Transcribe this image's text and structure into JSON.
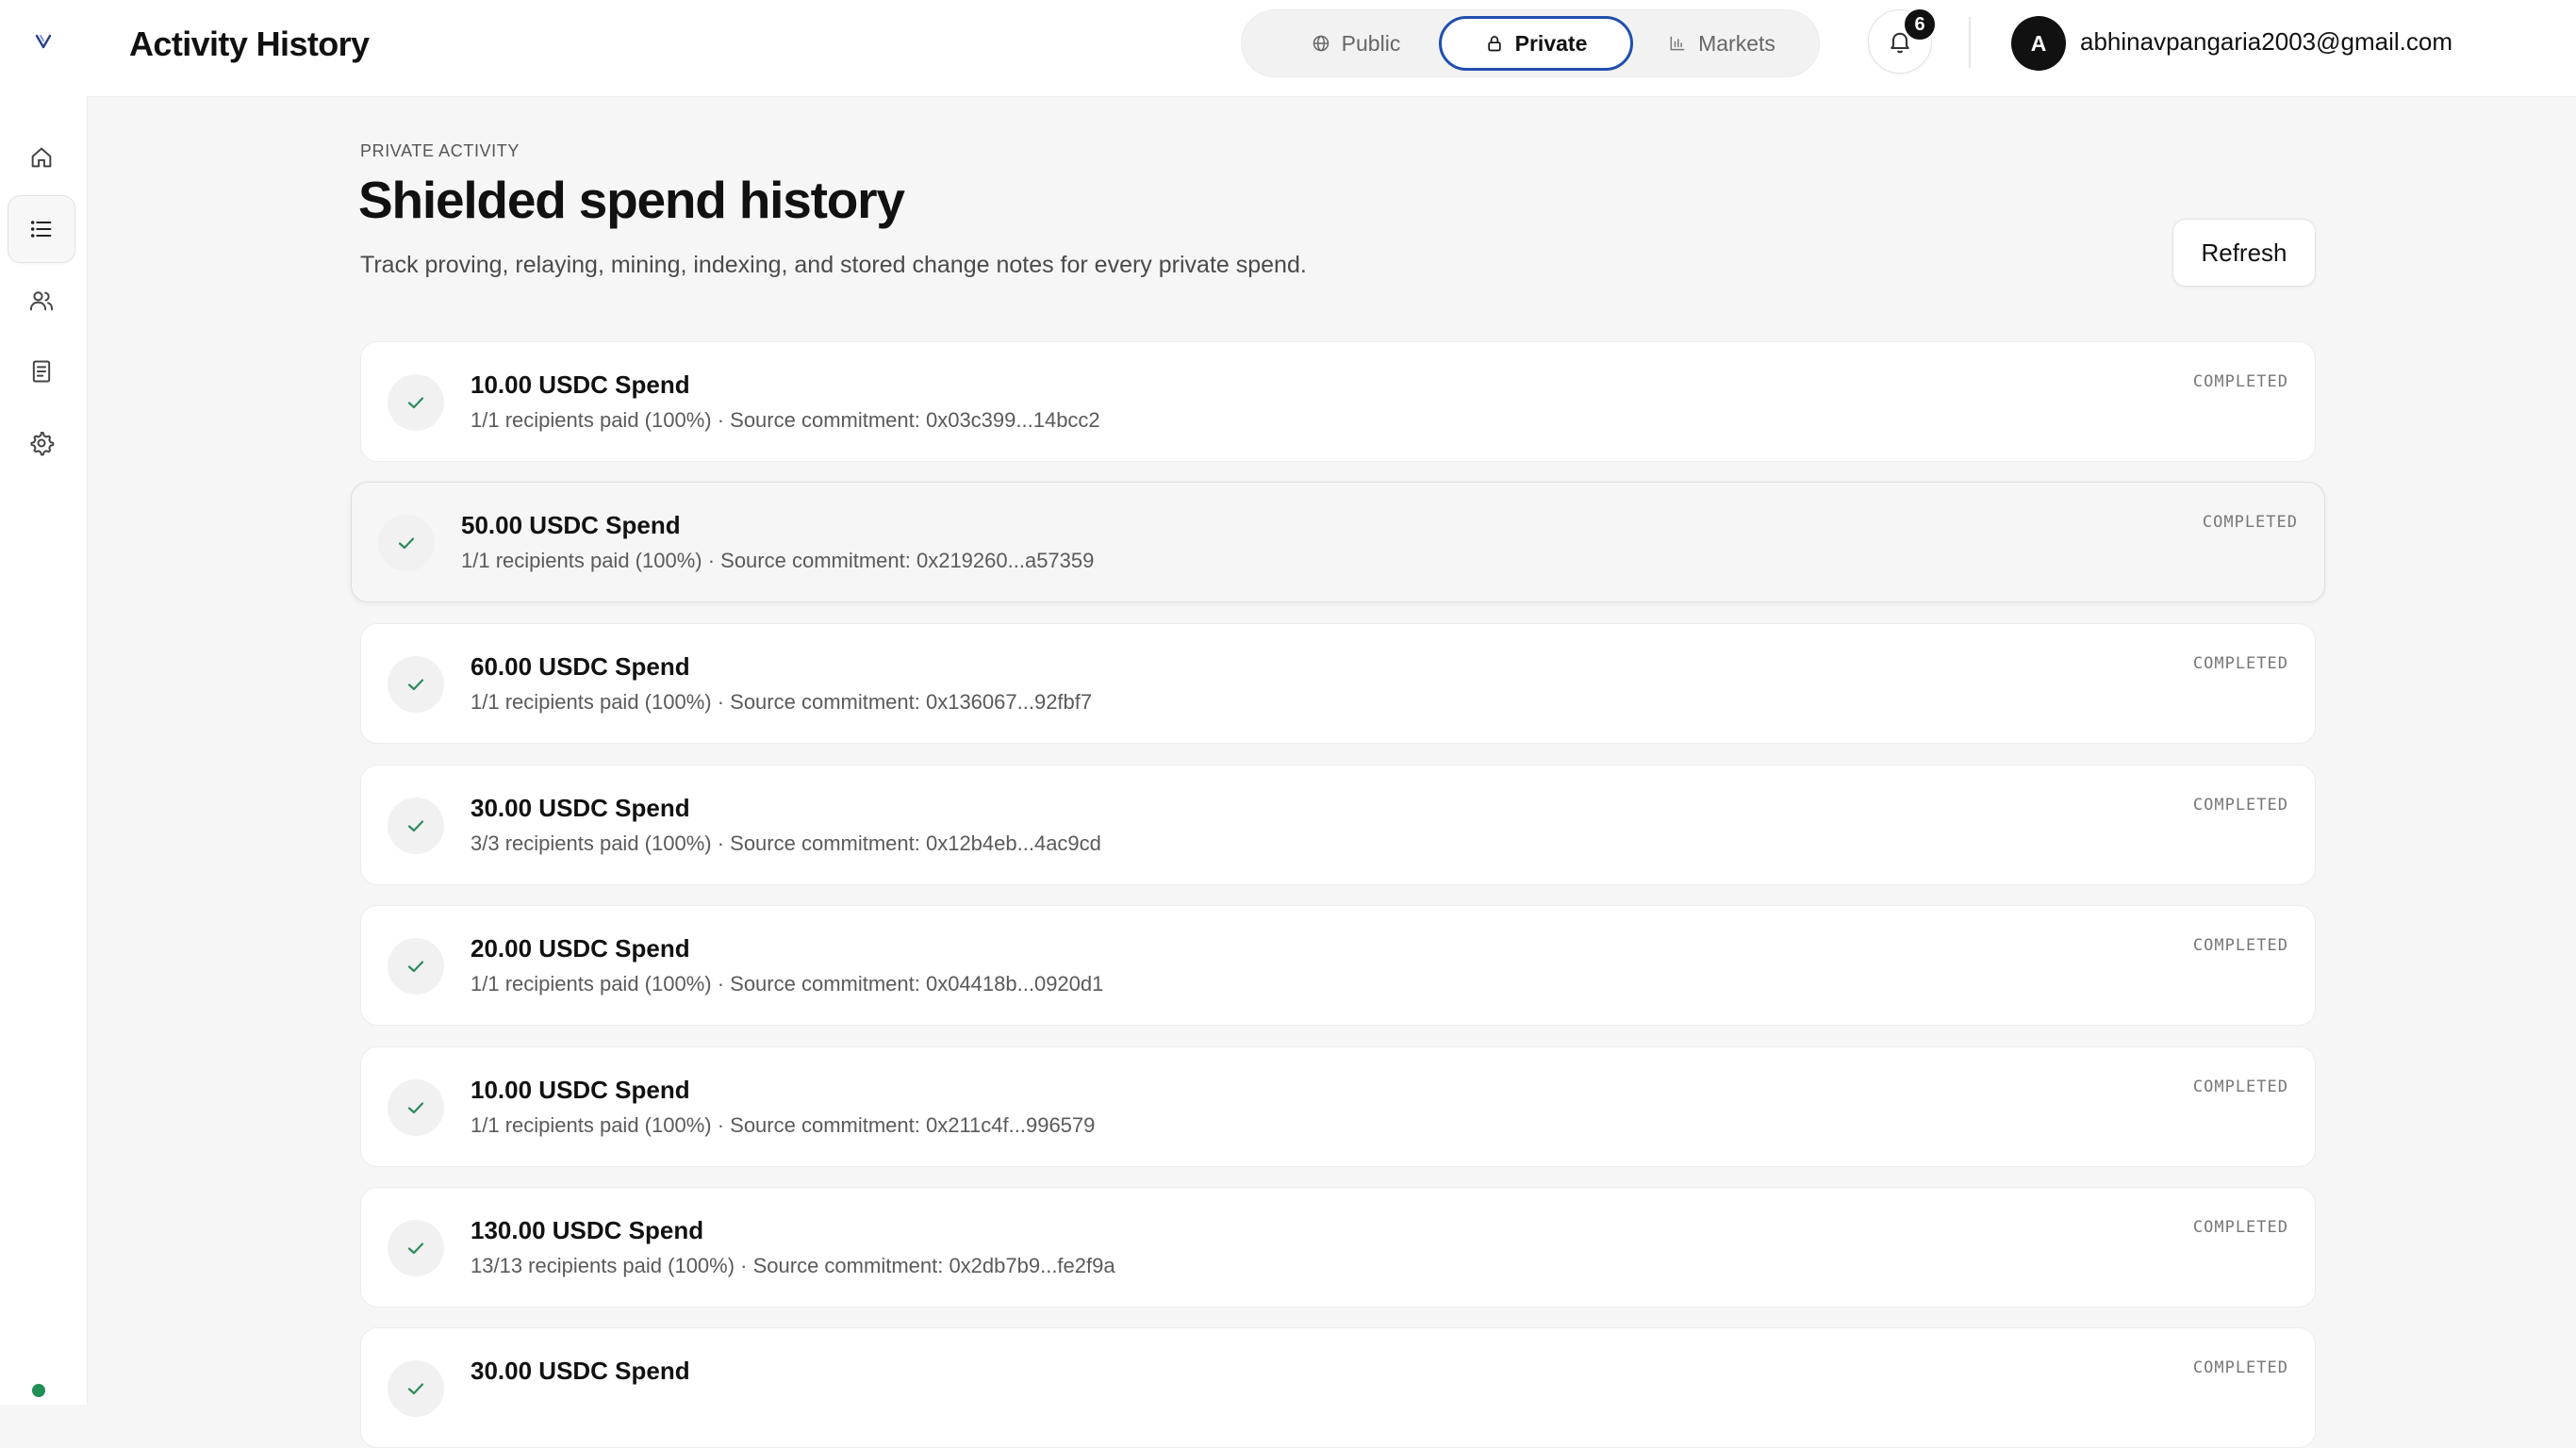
{
  "header": {
    "title": "Activity History",
    "modes": [
      {
        "label": "Public",
        "icon": "globe-icon"
      },
      {
        "label": "Private",
        "icon": "lock-icon",
        "active": true
      },
      {
        "label": "Markets",
        "icon": "bar-chart-icon"
      }
    ],
    "notifications_count": "6",
    "user_initial": "A",
    "user_email": "abhinavpangaria2003@gmail.com"
  },
  "sidebar": {
    "items": [
      {
        "icon": "home-icon"
      },
      {
        "icon": "list-icon",
        "active": true
      },
      {
        "icon": "users-icon"
      },
      {
        "icon": "document-icon"
      },
      {
        "icon": "gear-icon"
      }
    ]
  },
  "page": {
    "eyebrow": "PRIVATE ACTIVITY",
    "title": "Shielded spend history",
    "subtitle": "Track proving, relaying, mining, indexing, and stored change notes for every private spend.",
    "refresh_label": "Refresh"
  },
  "activities": [
    {
      "title": "10.00 USDC Spend",
      "meta": "1/1 recipients paid (100%) · Source commitment: 0x03c399...14bcc2",
      "status": "COMPLETED"
    },
    {
      "title": "50.00 USDC Spend",
      "meta": "1/1 recipients paid (100%) · Source commitment: 0x219260...a57359",
      "status": "COMPLETED"
    },
    {
      "title": "60.00 USDC Spend",
      "meta": "1/1 recipients paid (100%) · Source commitment: 0x136067...92fbf7",
      "status": "COMPLETED"
    },
    {
      "title": "30.00 USDC Spend",
      "meta": "3/3 recipients paid (100%) · Source commitment: 0x12b4eb...4ac9cd",
      "status": "COMPLETED"
    },
    {
      "title": "20.00 USDC Spend",
      "meta": "1/1 recipients paid (100%) · Source commitment: 0x04418b...0920d1",
      "status": "COMPLETED"
    },
    {
      "title": "10.00 USDC Spend",
      "meta": "1/1 recipients paid (100%) · Source commitment: 0x211c4f...996579",
      "status": "COMPLETED"
    },
    {
      "title": "130.00 USDC Spend",
      "meta": "13/13 recipients paid (100%) · Source commitment: 0x2db7b9...fe2f9a",
      "status": "COMPLETED"
    },
    {
      "title": "30.00 USDC Spend",
      "meta": "",
      "status": "COMPLETED"
    }
  ],
  "colors": {
    "accent": "#1f4fae",
    "status_dot": "#1f8f55",
    "check": "#2f8a5c"
  }
}
